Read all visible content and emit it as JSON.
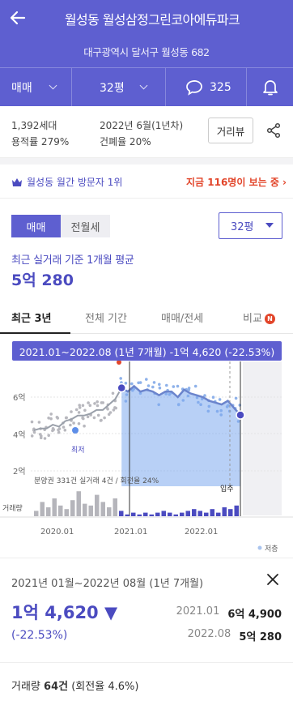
{
  "header": {
    "title": "월성동 월성삼정그린코아에듀파크",
    "address": "대구광역시 달서구 월성동 682",
    "deal_type": "매매",
    "size": "32평",
    "comment_count": "325"
  },
  "summary": {
    "households": "1,392세대",
    "floor_area_ratio": "용적률 279%",
    "completion": "2022년 6월(1년차)",
    "building_coverage": "건폐율 20%",
    "distance_button": "거리뷰"
  },
  "promo": {
    "rank_text": "월성동 월간 방문자 1위",
    "viewers_text": "지금 116명이 보는 중 ›"
  },
  "filters": {
    "seg_sale": "매매",
    "seg_rent": "전월세",
    "size_select": "32평"
  },
  "average": {
    "label": "최근 실거래 기준 1개월 평균",
    "value": "5억 280"
  },
  "tabs": {
    "recent3y": "최근 3년",
    "all": "전체 기간",
    "sale_rent": "매매/전세",
    "compare": "비교",
    "compare_badge": "N"
  },
  "chart_data": {
    "type": "line",
    "tooltip": "2021.01~2022.08 (1년 7개월)  -1억 4,620 (-22.53%)",
    "y_tick_labels": [
      "6억",
      "4억",
      "2억"
    ],
    "x_tick_labels": [
      "2020.01",
      "2021.01",
      "2022.01"
    ],
    "low_label": "최저",
    "move_in_label": "입주",
    "presale_info": "분양권 331건 실거래 4건 / 회전율 24%",
    "volume_label": "거래량",
    "legend_low": "저층",
    "price_series": [
      4.2,
      4.3,
      4.3,
      4.5,
      4.4,
      4.7,
      4.8,
      5.0,
      5.0,
      5.1,
      5.3,
      5.3,
      5.6,
      5.9,
      6.5,
      6.3,
      6.6,
      6.3,
      6.4,
      6.3,
      6.1,
      6.3,
      6.3,
      6.0,
      6.4,
      6.2,
      6.1,
      6.0,
      5.8,
      5.7,
      5.6,
      5.8,
      5.4,
      5.03
    ],
    "volume_series": [
      3,
      8,
      5,
      10,
      6,
      4,
      9,
      14,
      7,
      6,
      12,
      8,
      5,
      10,
      3,
      1,
      2,
      1,
      2,
      1,
      2,
      3,
      2,
      1,
      2,
      3,
      4,
      3,
      2,
      4,
      2,
      5,
      4,
      6
    ]
  },
  "detail": {
    "range": "2021년 01월~2022년 08월 (1년 7개월)",
    "change": "1억 4,620 ▼",
    "change_pct": "(-22.53%)",
    "from_date": "2021.01",
    "from_price": "6억 4,900",
    "to_date": "2022.08",
    "to_price": "5억 280",
    "volume_label": "거래량",
    "volume_count": "64건",
    "volume_rate": "(회전율 4.6%)"
  },
  "colors": {
    "brand": "#5e5fd0",
    "alert": "#e2452a"
  }
}
